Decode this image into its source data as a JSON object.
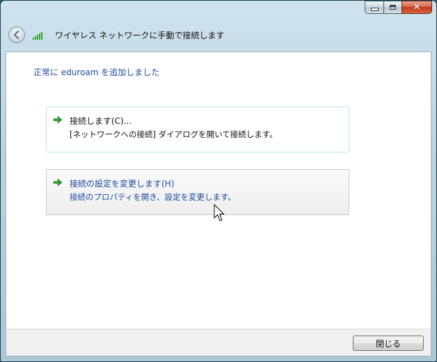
{
  "window": {
    "title": "ワイヤレス ネットワークに手動で接続します",
    "caption_buttons": {
      "minimize_icon": "minimize-icon",
      "maximize_icon": "maximize-icon",
      "close_glyph": "✕"
    }
  },
  "header": {
    "back_icon": "back-arrow-icon",
    "signal_icon": "wireless-signal-icon"
  },
  "content": {
    "success_message": "正常に eduroam を追加しました",
    "commands": [
      {
        "icon": "green-arrow-icon",
        "title": "接続します(C)...",
        "description": "[ネットワークへの接続] ダイアログを開いて接続します。"
      },
      {
        "icon": "green-arrow-icon",
        "title": "接続の設定を変更します(H)",
        "description": "接続のプロパティを開き、設定を変更します。"
      }
    ]
  },
  "footer": {
    "close_label": "閉じる"
  },
  "colors": {
    "link_blue": "#1f4aa0",
    "arrow_green": "#2e9e2e",
    "hover_border": "#b9e6f2"
  }
}
